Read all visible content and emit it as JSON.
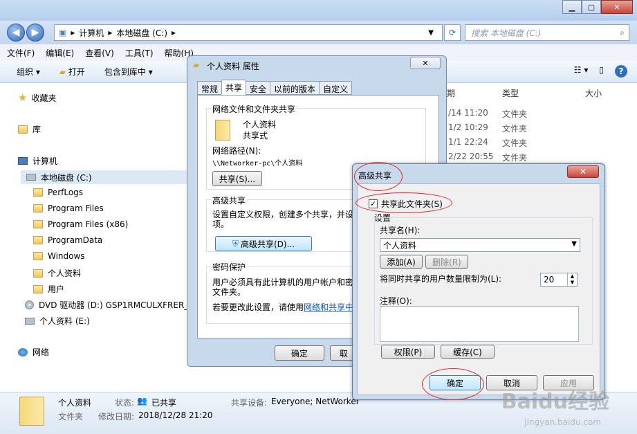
{
  "explorer": {
    "address": [
      "计算机",
      "本地磁盘 (C:)"
    ],
    "search_placeholder": "搜索 本地磁盘 (C:)",
    "menu": [
      "文件(F)",
      "编辑(E)",
      "查看(V)",
      "工具(T)",
      "帮助(H)"
    ],
    "toolbar": {
      "organize": "组织 ▾",
      "open": "打开",
      "include": "包含到库中 ▾"
    },
    "nav": {
      "favorites": "收藏夹",
      "libraries": "库",
      "computer": "计算机",
      "local_disk": "本地磁盘 (C:)",
      "folders": [
        "PerfLogs",
        "Program Files",
        "Program Files (x86)",
        "ProgramData",
        "Windows",
        "个人资料",
        "用户"
      ],
      "dvd": "DVD 驱动器 (D:) GSP1RMCULXFRER_C",
      "drive_e": "个人资料 (E:)",
      "network": "网络"
    },
    "columns": {
      "date": "期",
      "type": "类型",
      "size": "大小"
    },
    "rows": [
      {
        "date": "/14 11:20",
        "type": "文件夹"
      },
      {
        "date": "1/2 10:29",
        "type": "文件夹"
      },
      {
        "date": "1/1 22:24",
        "type": "文件夹"
      },
      {
        "date": "2/22 20:55",
        "type": "文件夹"
      }
    ],
    "status": {
      "name": "个人资料",
      "kind": "文件夹",
      "state_label": "状态:",
      "state_value": "已共享",
      "modified_label": "修改日期:",
      "modified_value": "2018/12/28 21:20",
      "share_label": "共享设备:",
      "share_value": "Everyone; NetWorker"
    }
  },
  "props": {
    "title": "个人资料 属性",
    "tabs": [
      "常规",
      "共享",
      "安全",
      "以前的版本",
      "自定义"
    ],
    "network_group": "网络文件和文件夹共享",
    "folder_name": "个人资料",
    "folder_state": "共享式",
    "network_path_label": "网络路径(N):",
    "network_path": "\\\\Networker-pc\\个人资料",
    "share_button": "共享(S)...",
    "advanced_group": "高级共享",
    "advanced_desc": "设置自定义权限，创建多个共享，并设",
    "advanced_desc2": "项。",
    "advanced_button": "高级共享(D)...",
    "password_group": "密码保护",
    "password_desc": "用户必须具有此计算机的用户帐户和密",
    "password_desc2": "文件夹。",
    "change_prefix": "若要更改此设置，请使用",
    "change_link": "网络和共享中",
    "ok": "确定",
    "cancel": "取"
  },
  "adv": {
    "title": "高级共享",
    "share_checkbox": "共享此文件夹(S)",
    "settings_label": "设置",
    "share_name_label": "共享名(H):",
    "share_name_value": "个人资料",
    "add_button": "添加(A)",
    "remove_button": "删除(R)",
    "limit_label": "将同时共享的用户数量限制为(L):",
    "limit_value": "20",
    "comment_label": "注释(O):",
    "permissions_button": "权限(P)",
    "cache_button": "缓存(C)",
    "ok": "确定",
    "cancel": "取消",
    "apply": "应用"
  },
  "watermark": {
    "logo": "Baidu经验",
    "url": "jingyan.baidu.com"
  }
}
